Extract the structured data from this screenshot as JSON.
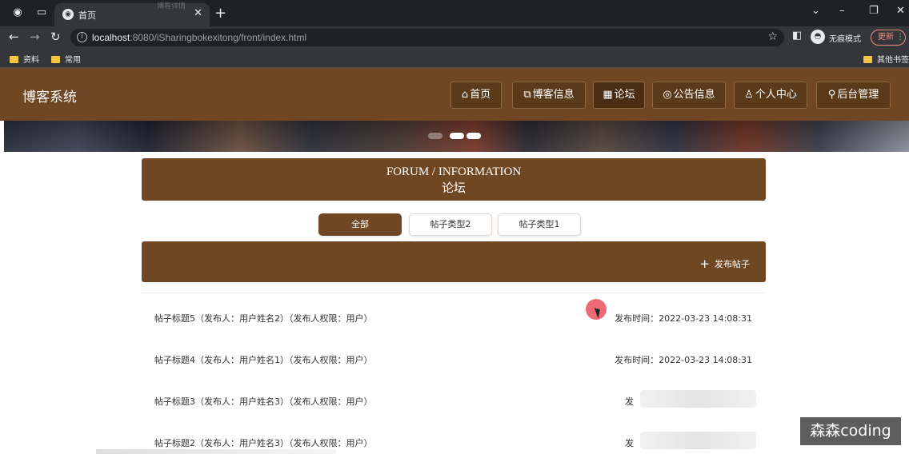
{
  "browser": {
    "tab_title": "首页",
    "ghost_text": "博客详情",
    "url_host": "localhost",
    "url_rest": ":8080/iSharingbokexitong/front/index.html",
    "incognito_label": "无痕模式",
    "update_label": "更新",
    "bookmarks": [
      "资料",
      "常用"
    ],
    "other_bookmarks": "其他书签"
  },
  "site": {
    "logo": "博客系统",
    "nav": [
      {
        "icon": "⌂",
        "label": "首页"
      },
      {
        "icon": "⧉",
        "label": "博客信息"
      },
      {
        "icon": "▦",
        "label": "论坛"
      },
      {
        "icon": "◎",
        "label": "公告信息"
      },
      {
        "icon": "♙",
        "label": "个人中心"
      },
      {
        "icon": "⚲",
        "label": "后台管理"
      }
    ]
  },
  "forum": {
    "title_en": "FORUM / INFORMATION",
    "title_cn": "论坛",
    "filters": [
      "全部",
      "帖子类型2",
      "帖子类型1"
    ],
    "post_button": "发布帖子",
    "posts": [
      {
        "title": "帖子标题5（发布人：用户姓名2）（发布人权限：用户）",
        "date": "发布时间：2022-03-23 14:08:31"
      },
      {
        "title": "帖子标题4（发布人：用户姓名1）（发布人权限：用户）",
        "date": "发布时间：2022-03-23 14:08:31"
      },
      {
        "title": "帖子标题3（发布人：用户姓名3）（发布人权限：用户）",
        "date": "发"
      },
      {
        "title": "帖子标题2（发布人：用户姓名3）（发布人权限：用户）",
        "date": "发"
      }
    ]
  },
  "watermark": "森森coding",
  "colors": {
    "brand_brown": "#6f4823",
    "chrome_dark": "#202124",
    "chrome_mid": "#35363a"
  }
}
